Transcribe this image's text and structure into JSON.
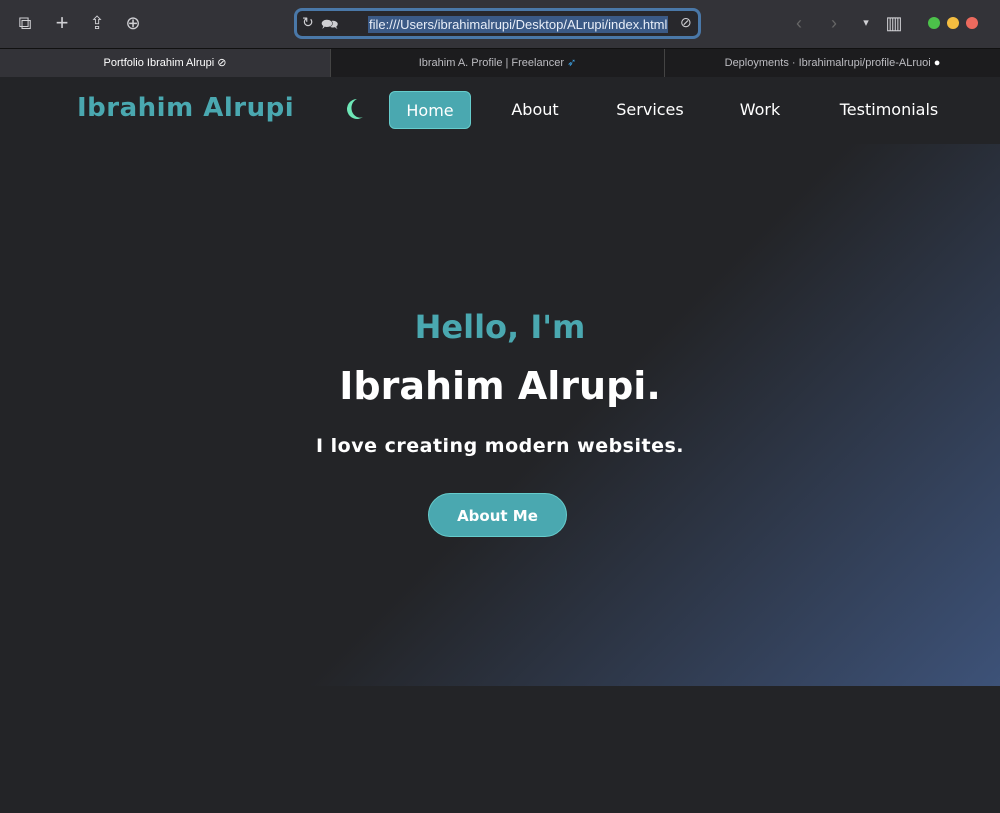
{
  "browser": {
    "url": "file:///Users/ibrahimalrupi/Desktop/ALrupi/index.html",
    "tabs": [
      {
        "label": "Portfolio Ibrahim Alrupi",
        "active": true
      },
      {
        "label": "Ibrahim A. Profile | Freelancer"
      },
      {
        "label": "Deployments · Ibrahimalrupi/profile-ALruoi"
      }
    ]
  },
  "nav": {
    "logo": "Ibrahim Alrupi",
    "items": [
      "Home",
      "About",
      "Services",
      "Work",
      "Testimonials"
    ]
  },
  "hero": {
    "greeting": "Hello, I'm",
    "name": "Ibrahim Alrupi.",
    "tagline": "I love creating modern websites.",
    "button": "About Me"
  },
  "colors": {
    "accent": "#4aa8b0",
    "moon": "#6ee7b7"
  }
}
